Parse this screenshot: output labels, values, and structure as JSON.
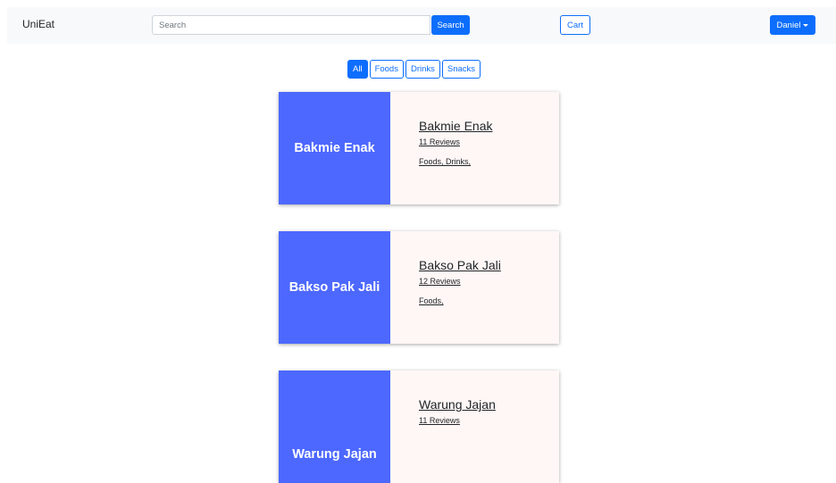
{
  "navbar": {
    "brand": "UniEat",
    "search_placeholder": "Search",
    "search_button": "Search",
    "cart_button": "Cart",
    "user_button": "Daniel"
  },
  "filters": [
    "All",
    "Foods",
    "Drinks",
    "Snacks"
  ],
  "restaurants": [
    {
      "name": "Bakmie Enak",
      "reviews": "11 Reviews",
      "categories": "Foods, Drinks,"
    },
    {
      "name": "Bakso Pak Jali",
      "reviews": "12 Reviews",
      "categories": "Foods,"
    },
    {
      "name": "Warung Jajan",
      "reviews": "11 Reviews",
      "categories": ""
    }
  ],
  "colors": {
    "primary": "#0d6efd",
    "card_accent": "#4d68ff",
    "card_body": "#fff7f6",
    "navbar_bg": "#f8f9fa"
  }
}
